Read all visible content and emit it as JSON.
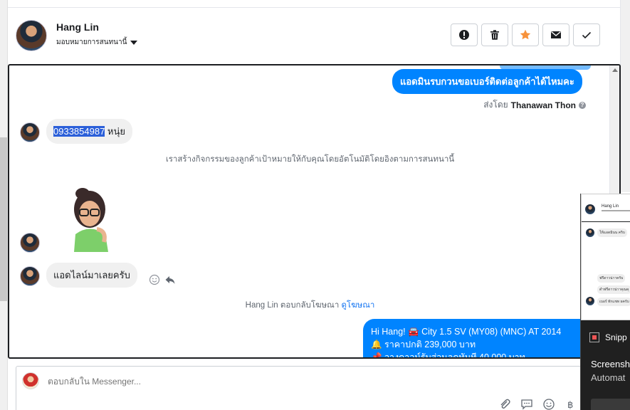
{
  "header": {
    "contact_name": "Hang Lin",
    "assign_label": "มอบหมายการสนทนานี้"
  },
  "actions": [
    {
      "name": "spam-button",
      "icon": "exclamation-icon"
    },
    {
      "name": "delete-button",
      "icon": "trash-icon"
    },
    {
      "name": "star-button",
      "icon": "star-icon",
      "color": "#f7923b"
    },
    {
      "name": "mark-unread-button",
      "icon": "envelope-icon"
    },
    {
      "name": "mark-done-button",
      "icon": "check-icon"
    }
  ],
  "messages": {
    "outgoing_1": "แอดมินรบกวนขอเบอร์ติดต่อลูกค้าได้ไหมคะ",
    "sent_by_prefix": "ส่งโดย",
    "sent_by_name": "Thanawan Thon",
    "incoming_phone": "0933854987",
    "incoming_phone_suffix": " หนุ่ย",
    "system_note": "เราสร้างกิจกรรมของลูกค้าเป้าหมายให้กับคุณโดยอัตโนมัติโดยอิงตามการสนทนานี้",
    "incoming_line": "แอดไลน์มาเลยครับ",
    "ad_reply_note": "Hang Lin ตอบกลับโฆษณา ",
    "ad_reply_link": "ดูโฆษณา",
    "promo_line1": "Hi Hang! 🚘 City 1.5 SV (MY08) (MNC) AT 2014",
    "promo_line2": "🔔  ราคาปกติ  239,000 บาท",
    "promo_line3": "📌 วางดาวน์รับส่วนลดทันที 40,000 บาท"
  },
  "composer": {
    "placeholder": "ตอบกลับใน Messenger..."
  },
  "snip_overlay": {
    "app_name": "Snipp",
    "title": "Screensh",
    "subtitle": "Automat",
    "thumb_name": "Hang Lin",
    "thumb_msgs": [
      "ให้แอดมินน คริบ",
      "ฟรีดาวน่าาครับ",
      "ดำฟรีดาวน่าาคุณคุ",
      "เบอร์ ทักแชท ผครับ"
    ]
  },
  "colors": {
    "brand_blue": "#0084ff",
    "star_orange": "#f7923b",
    "link_blue": "#1877f2",
    "selection_blue": "#2b5fd9"
  }
}
